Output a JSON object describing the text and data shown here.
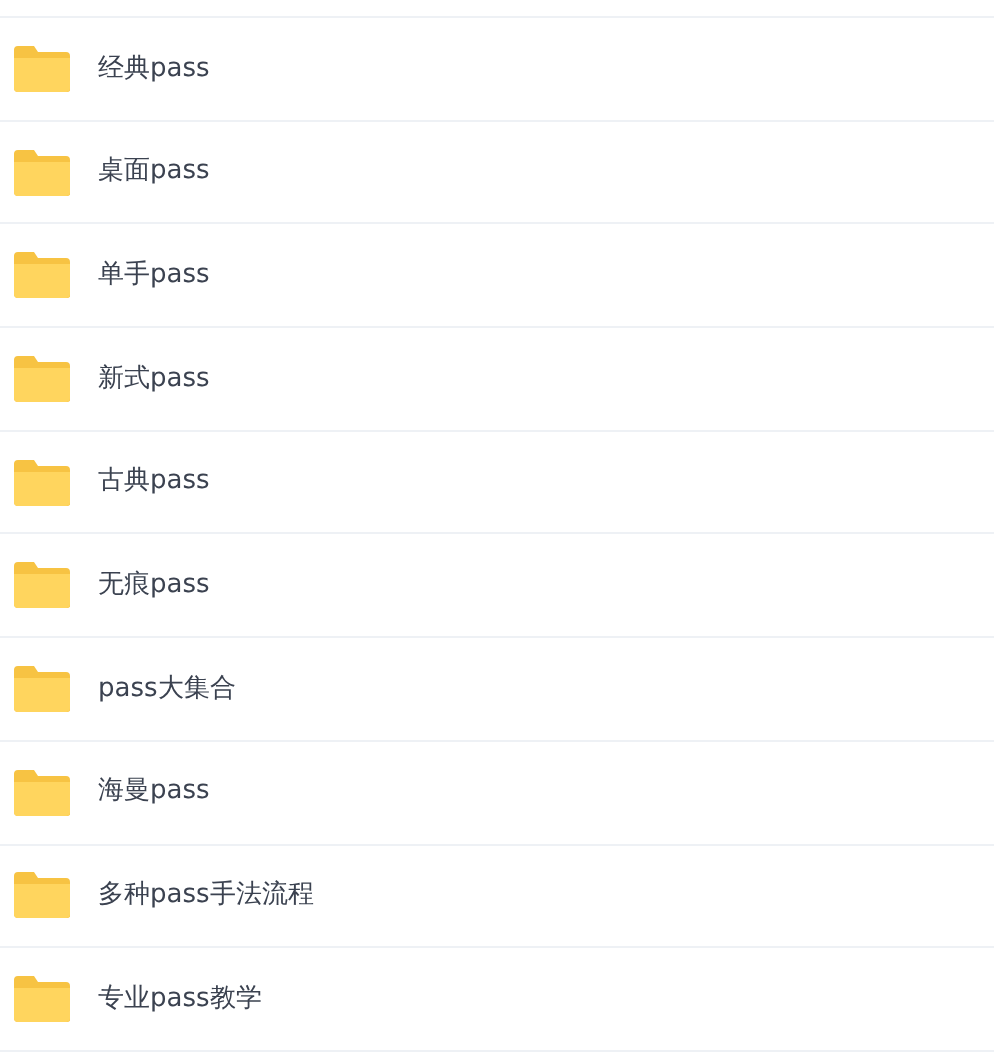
{
  "folders": [
    {
      "name": "经典pass"
    },
    {
      "name": "桌面pass"
    },
    {
      "name": "单手pass"
    },
    {
      "name": "新式pass"
    },
    {
      "name": "古典pass"
    },
    {
      "name": "无痕pass"
    },
    {
      "name": "pass大集合"
    },
    {
      "name": "海曼pass"
    },
    {
      "name": "多种pass手法流程"
    },
    {
      "name": "专业pass教学"
    }
  ]
}
